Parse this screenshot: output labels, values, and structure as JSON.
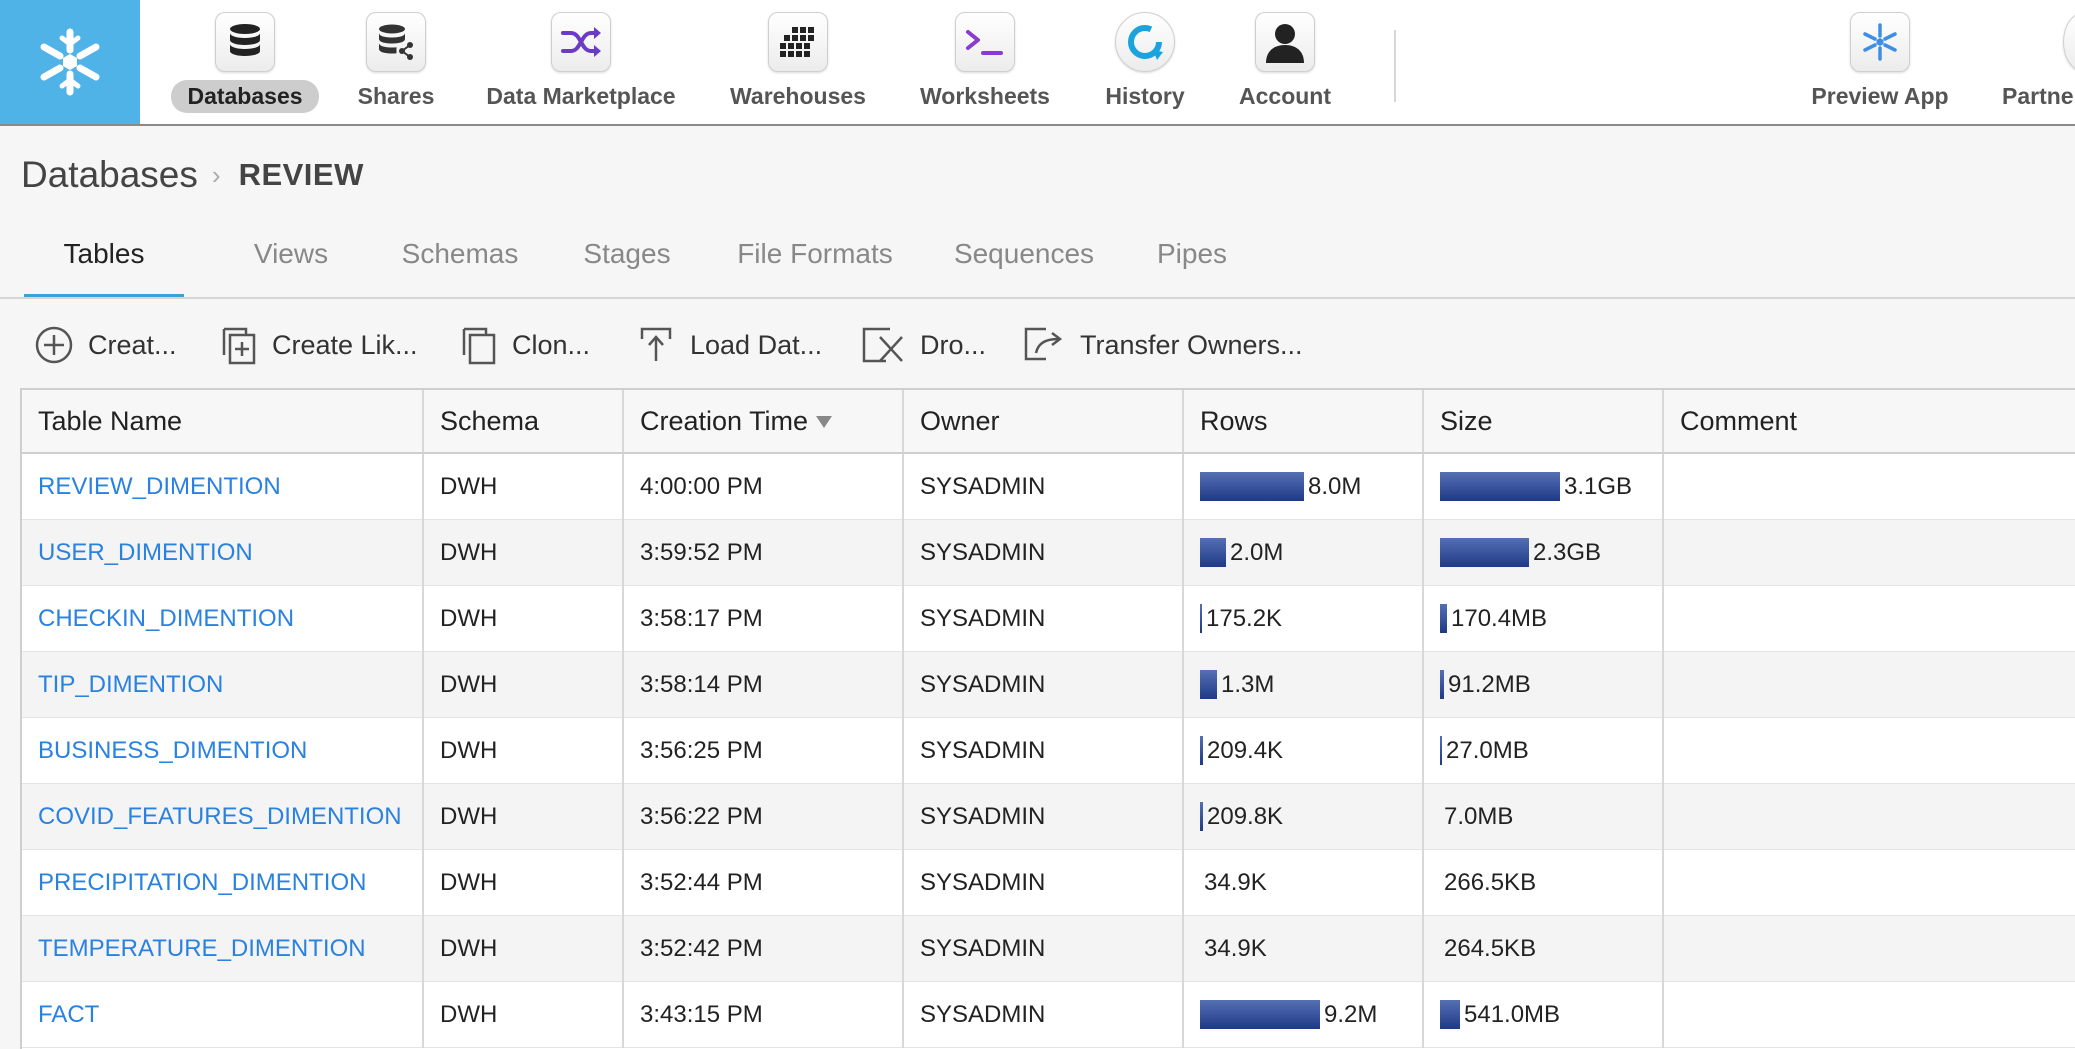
{
  "nav": {
    "items": [
      {
        "label": "Databases",
        "icon": "database-icon",
        "active": true
      },
      {
        "label": "Shares",
        "icon": "shares-icon"
      },
      {
        "label": "Data Marketplace",
        "icon": "shuffle-icon"
      },
      {
        "label": "Warehouses",
        "icon": "grid-icon"
      },
      {
        "label": "Worksheets",
        "icon": "terminal-icon"
      },
      {
        "label": "History",
        "icon": "history-icon"
      },
      {
        "label": "Account",
        "icon": "user-icon"
      },
      {
        "label": "Preview App",
        "icon": "snowflake-icon"
      },
      {
        "label": "Partner",
        "icon": "partner-icon"
      }
    ]
  },
  "breadcrumb": {
    "root": "Databases",
    "current": "REVIEW"
  },
  "tabs": [
    "Tables",
    "Views",
    "Schemas",
    "Stages",
    "File Formats",
    "Sequences",
    "Pipes"
  ],
  "toolbar": [
    "Creat...",
    "Create Lik...",
    "Clon...",
    "Load Dat...",
    "Dro...",
    "Transfer Owners..."
  ],
  "table": {
    "columns": [
      "Table Name",
      "Schema",
      "Creation Time",
      "Owner",
      "Rows",
      "Size",
      "Comment"
    ],
    "rows": [
      {
        "name": "REVIEW_DIMENTION",
        "schema": "DWH",
        "created": "4:00:00 PM",
        "owner": "SYSADMIN",
        "rows": "8.0M",
        "rows_bar": 0.87,
        "size": "3.1GB",
        "size_bar": 1.0,
        "comment": ""
      },
      {
        "name": "USER_DIMENTION",
        "schema": "DWH",
        "created": "3:59:52 PM",
        "owner": "SYSADMIN",
        "rows": "2.0M",
        "rows_bar": 0.22,
        "size": "2.3GB",
        "size_bar": 0.74,
        "comment": ""
      },
      {
        "name": "CHECKIN_DIMENTION",
        "schema": "DWH",
        "created": "3:58:17 PM",
        "owner": "SYSADMIN",
        "rows": "175.2K",
        "rows_bar": 0.02,
        "size": "170.4MB",
        "size_bar": 0.055,
        "comment": ""
      },
      {
        "name": "TIP_DIMENTION",
        "schema": "DWH",
        "created": "3:58:14 PM",
        "owner": "SYSADMIN",
        "rows": "1.3M",
        "rows_bar": 0.14,
        "size": "91.2MB",
        "size_bar": 0.03,
        "comment": ""
      },
      {
        "name": "BUSINESS_DIMENTION",
        "schema": "DWH",
        "created": "3:56:25 PM",
        "owner": "SYSADMIN",
        "rows": "209.4K",
        "rows_bar": 0.023,
        "size": "27.0MB",
        "size_bar": 0.009,
        "comment": ""
      },
      {
        "name": "COVID_FEATURES_DIMENTION",
        "schema": "DWH",
        "created": "3:56:22 PM",
        "owner": "SYSADMIN",
        "rows": "209.8K",
        "rows_bar": 0.023,
        "size": "7.0MB",
        "size_bar": 0.0,
        "comment": ""
      },
      {
        "name": "PRECIPITATION_DIMENTION",
        "schema": "DWH",
        "created": "3:52:44 PM",
        "owner": "SYSADMIN",
        "rows": "34.9K",
        "rows_bar": 0.0,
        "size": "266.5KB",
        "size_bar": 0.0,
        "comment": ""
      },
      {
        "name": "TEMPERATURE_DIMENTION",
        "schema": "DWH",
        "created": "3:52:42 PM",
        "owner": "SYSADMIN",
        "rows": "34.9K",
        "rows_bar": 0.0,
        "size": "264.5KB",
        "size_bar": 0.0,
        "comment": ""
      },
      {
        "name": "FACT",
        "schema": "DWH",
        "created": "3:43:15 PM",
        "owner": "SYSADMIN",
        "rows": "9.2M",
        "rows_bar": 1.0,
        "size": "541.0MB",
        "size_bar": 0.17,
        "comment": ""
      }
    ]
  },
  "colors": {
    "brand": "#4fb3e8",
    "link": "#2a82e0",
    "bar": "#2b4795",
    "tab_active": "#3aa0de"
  }
}
